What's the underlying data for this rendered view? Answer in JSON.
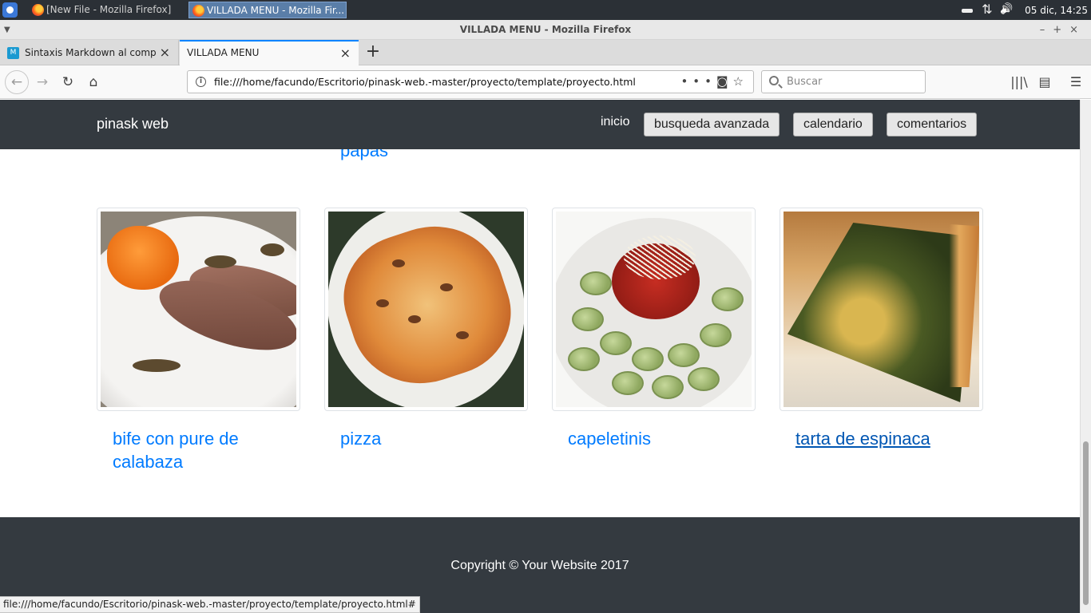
{
  "taskbar": {
    "tasks": [
      {
        "label": "[New File - Mozilla Firefox]"
      },
      {
        "label": "VILLADA MENU - Mozilla Fir..."
      }
    ],
    "clock": "05 dic, 14:25"
  },
  "window": {
    "title": "VILLADA MENU - Mozilla Firefox"
  },
  "tabs": [
    {
      "label": "Sintaxis Markdown al complet"
    },
    {
      "label": "VILLADA MENU"
    }
  ],
  "toolbar": {
    "url": "file:///home/facundo/Escritorio/pinask-web.-master/proyecto/template/proyecto.html",
    "search_placeholder": "Buscar"
  },
  "site": {
    "brand": "pinask web",
    "nav": {
      "inicio": "inicio",
      "buttons": [
        "busqueda avanzada",
        "calendario",
        "comentarios"
      ]
    },
    "partial_title": "papas",
    "cards": [
      {
        "title": "bife con pure de calabaza",
        "image": "steak-with-squash-puree"
      },
      {
        "title": "pizza",
        "image": "pizza-on-plate"
      },
      {
        "title": "capeletinis",
        "image": "spinach-capeletti-with-tomato-sauce"
      },
      {
        "title": "tarta de espinaca",
        "image": "spinach-tart-slice"
      }
    ],
    "footer": "Copyright © Your Website 2017"
  },
  "status_bar": {
    "link": "file:///home/facundo/Escritorio/pinask-web.-master/proyecto/template/proyecto.html#"
  },
  "colors": {
    "navbar_bg": "#343a40",
    "link": "#007bff",
    "link_hover": "#0056b3"
  }
}
